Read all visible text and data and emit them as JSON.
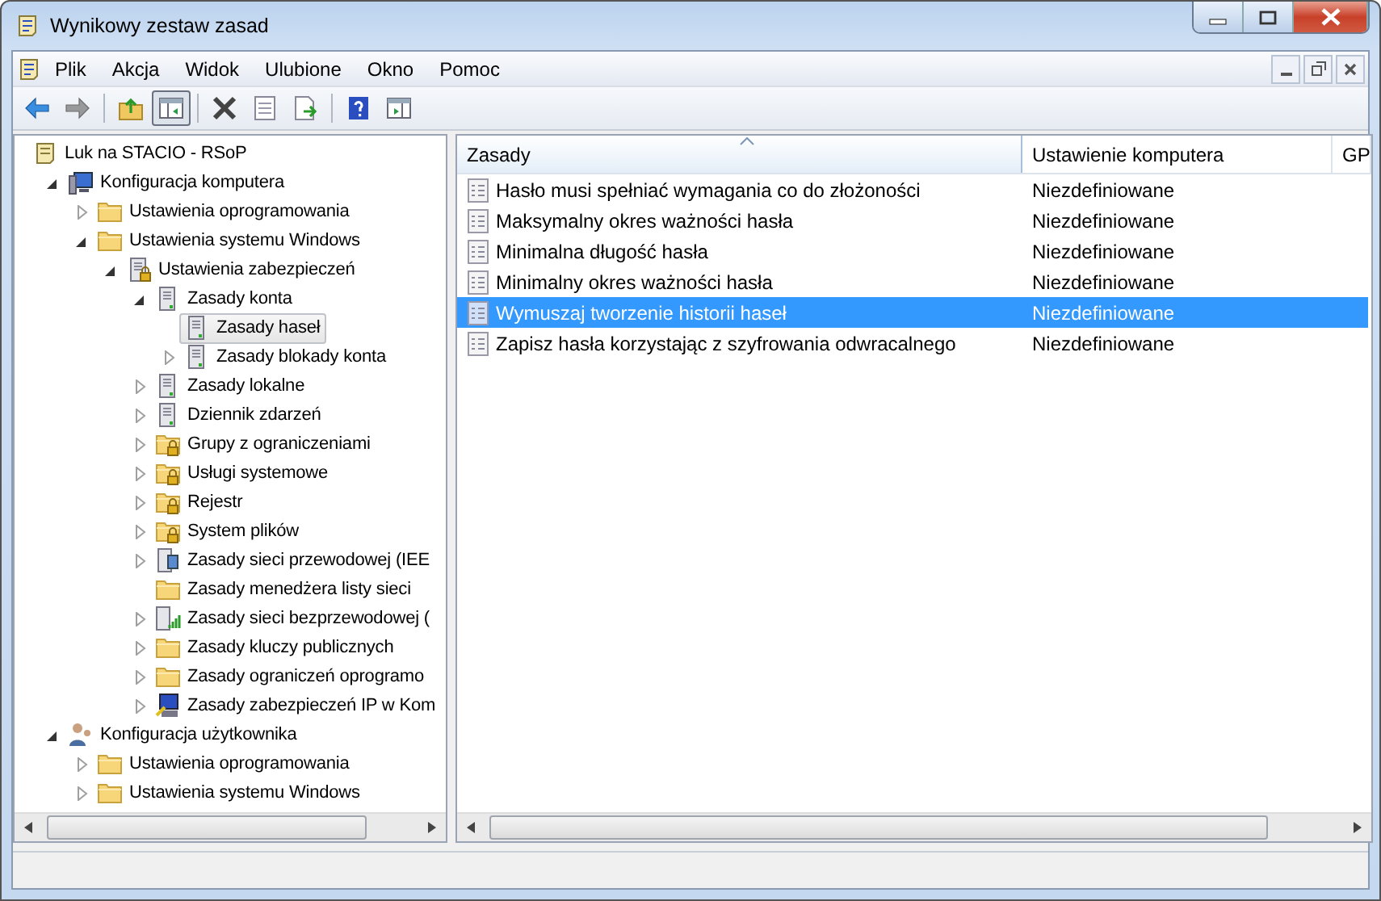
{
  "window": {
    "title": "Wynikowy zestaw zasad"
  },
  "menu": [
    {
      "label": "Plik"
    },
    {
      "label": "Akcja"
    },
    {
      "label": "Widok"
    },
    {
      "label": "Ulubione"
    },
    {
      "label": "Okno"
    },
    {
      "label": "Pomoc"
    }
  ],
  "toolbar": [
    {
      "kind": "back",
      "disabled": false,
      "pressed": false
    },
    {
      "kind": "forward",
      "disabled": true,
      "pressed": false
    },
    {
      "kind": "sep"
    },
    {
      "kind": "up",
      "disabled": false,
      "pressed": false
    },
    {
      "kind": "pane",
      "disabled": false,
      "pressed": true
    },
    {
      "kind": "sep"
    },
    {
      "kind": "delete",
      "disabled": false,
      "pressed": false
    },
    {
      "kind": "properties",
      "disabled": false,
      "pressed": false
    },
    {
      "kind": "export",
      "disabled": false,
      "pressed": false
    },
    {
      "kind": "sep"
    },
    {
      "kind": "help",
      "disabled": false,
      "pressed": false
    },
    {
      "kind": "action-pane",
      "disabled": false,
      "pressed": false
    }
  ],
  "tree": {
    "label": "Luk na STACIO - RSoP",
    "kind": "scroll",
    "selected": false,
    "children": [
      {
        "label": "Konfiguracja komputera",
        "kind": "computer",
        "expanded": true,
        "selected": false,
        "children": [
          {
            "label": "Ustawienia oprogramowania",
            "kind": "folder",
            "expanded": false,
            "selected": false
          },
          {
            "label": "Ustawienia systemu Windows",
            "kind": "folder",
            "expanded": true,
            "selected": false,
            "children": [
              {
                "label": "Ustawienia zabezpieczeń",
                "kind": "lock-server",
                "expanded": true,
                "selected": false,
                "children": [
                  {
                    "label": "Zasady konta",
                    "kind": "server",
                    "expanded": true,
                    "selected": false,
                    "children": [
                      {
                        "label": "Zasady haseł",
                        "kind": "server",
                        "selected": true
                      },
                      {
                        "label": "Zasady blokady konta",
                        "kind": "server",
                        "expanded": false,
                        "selected": false
                      }
                    ]
                  },
                  {
                    "label": "Zasady lokalne",
                    "kind": "server",
                    "expanded": false,
                    "selected": false
                  },
                  {
                    "label": "Dziennik zdarzeń",
                    "kind": "server",
                    "expanded": false,
                    "selected": false
                  },
                  {
                    "label": "Grupy z ograniczeniami",
                    "kind": "lock-folder",
                    "expanded": false,
                    "selected": false
                  },
                  {
                    "label": "Usługi systemowe",
                    "kind": "lock-folder",
                    "expanded": false,
                    "selected": false
                  },
                  {
                    "label": "Rejestr",
                    "kind": "lock-folder",
                    "expanded": false,
                    "selected": false
                  },
                  {
                    "label": "System plików",
                    "kind": "lock-folder",
                    "expanded": false,
                    "selected": false
                  },
                  {
                    "label": "Zasady sieci przewodowej (IEE",
                    "kind": "network",
                    "expanded": false,
                    "selected": false
                  },
                  {
                    "label": "Zasady menedżera listy sieci",
                    "kind": "folder",
                    "selected": false
                  },
                  {
                    "label": "Zasady sieci bezprzewodowej (",
                    "kind": "wireless",
                    "expanded": false,
                    "selected": false
                  },
                  {
                    "label": "Zasady kluczy publicznych",
                    "kind": "folder",
                    "expanded": false,
                    "selected": false
                  },
                  {
                    "label": "Zasady ograniczeń oprogramo",
                    "kind": "folder",
                    "expanded": false,
                    "selected": false
                  },
                  {
                    "label": "Zasady zabezpieczeń IP w Kom",
                    "kind": "ip",
                    "expanded": false,
                    "selected": false
                  }
                ]
              }
            ]
          }
        ]
      },
      {
        "label": "Konfiguracja użytkownika",
        "kind": "user",
        "expanded": true,
        "selected": false,
        "children": [
          {
            "label": "Ustawienia oprogramowania",
            "kind": "folder",
            "expanded": false,
            "selected": false
          },
          {
            "label": "Ustawienia systemu Windows",
            "kind": "folder",
            "expanded": false,
            "selected": false
          }
        ]
      }
    ]
  },
  "table": {
    "columns": [
      {
        "label": "Zasady",
        "sorted": true
      },
      {
        "label": "Ustawienie komputera",
        "sorted": false
      },
      {
        "label": "GP",
        "sorted": false
      }
    ],
    "rows": [
      {
        "policy": "Hasło musi spełniać wymagania co do złożoności",
        "setting": "Niezdefiniowane",
        "selected": false
      },
      {
        "policy": "Maksymalny okres ważności hasła",
        "setting": "Niezdefiniowane",
        "selected": false
      },
      {
        "policy": "Minimalna długość hasła",
        "setting": "Niezdefiniowane",
        "selected": false
      },
      {
        "policy": "Minimalny okres ważności hasła",
        "setting": "Niezdefiniowane",
        "selected": false
      },
      {
        "policy": "Wymuszaj tworzenie historii haseł",
        "setting": "Niezdefiniowane",
        "selected": true
      },
      {
        "policy": "Zapisz hasła korzystając z szyfrowania odwracalnego",
        "setting": "Niezdefiniowane",
        "selected": false
      }
    ]
  }
}
